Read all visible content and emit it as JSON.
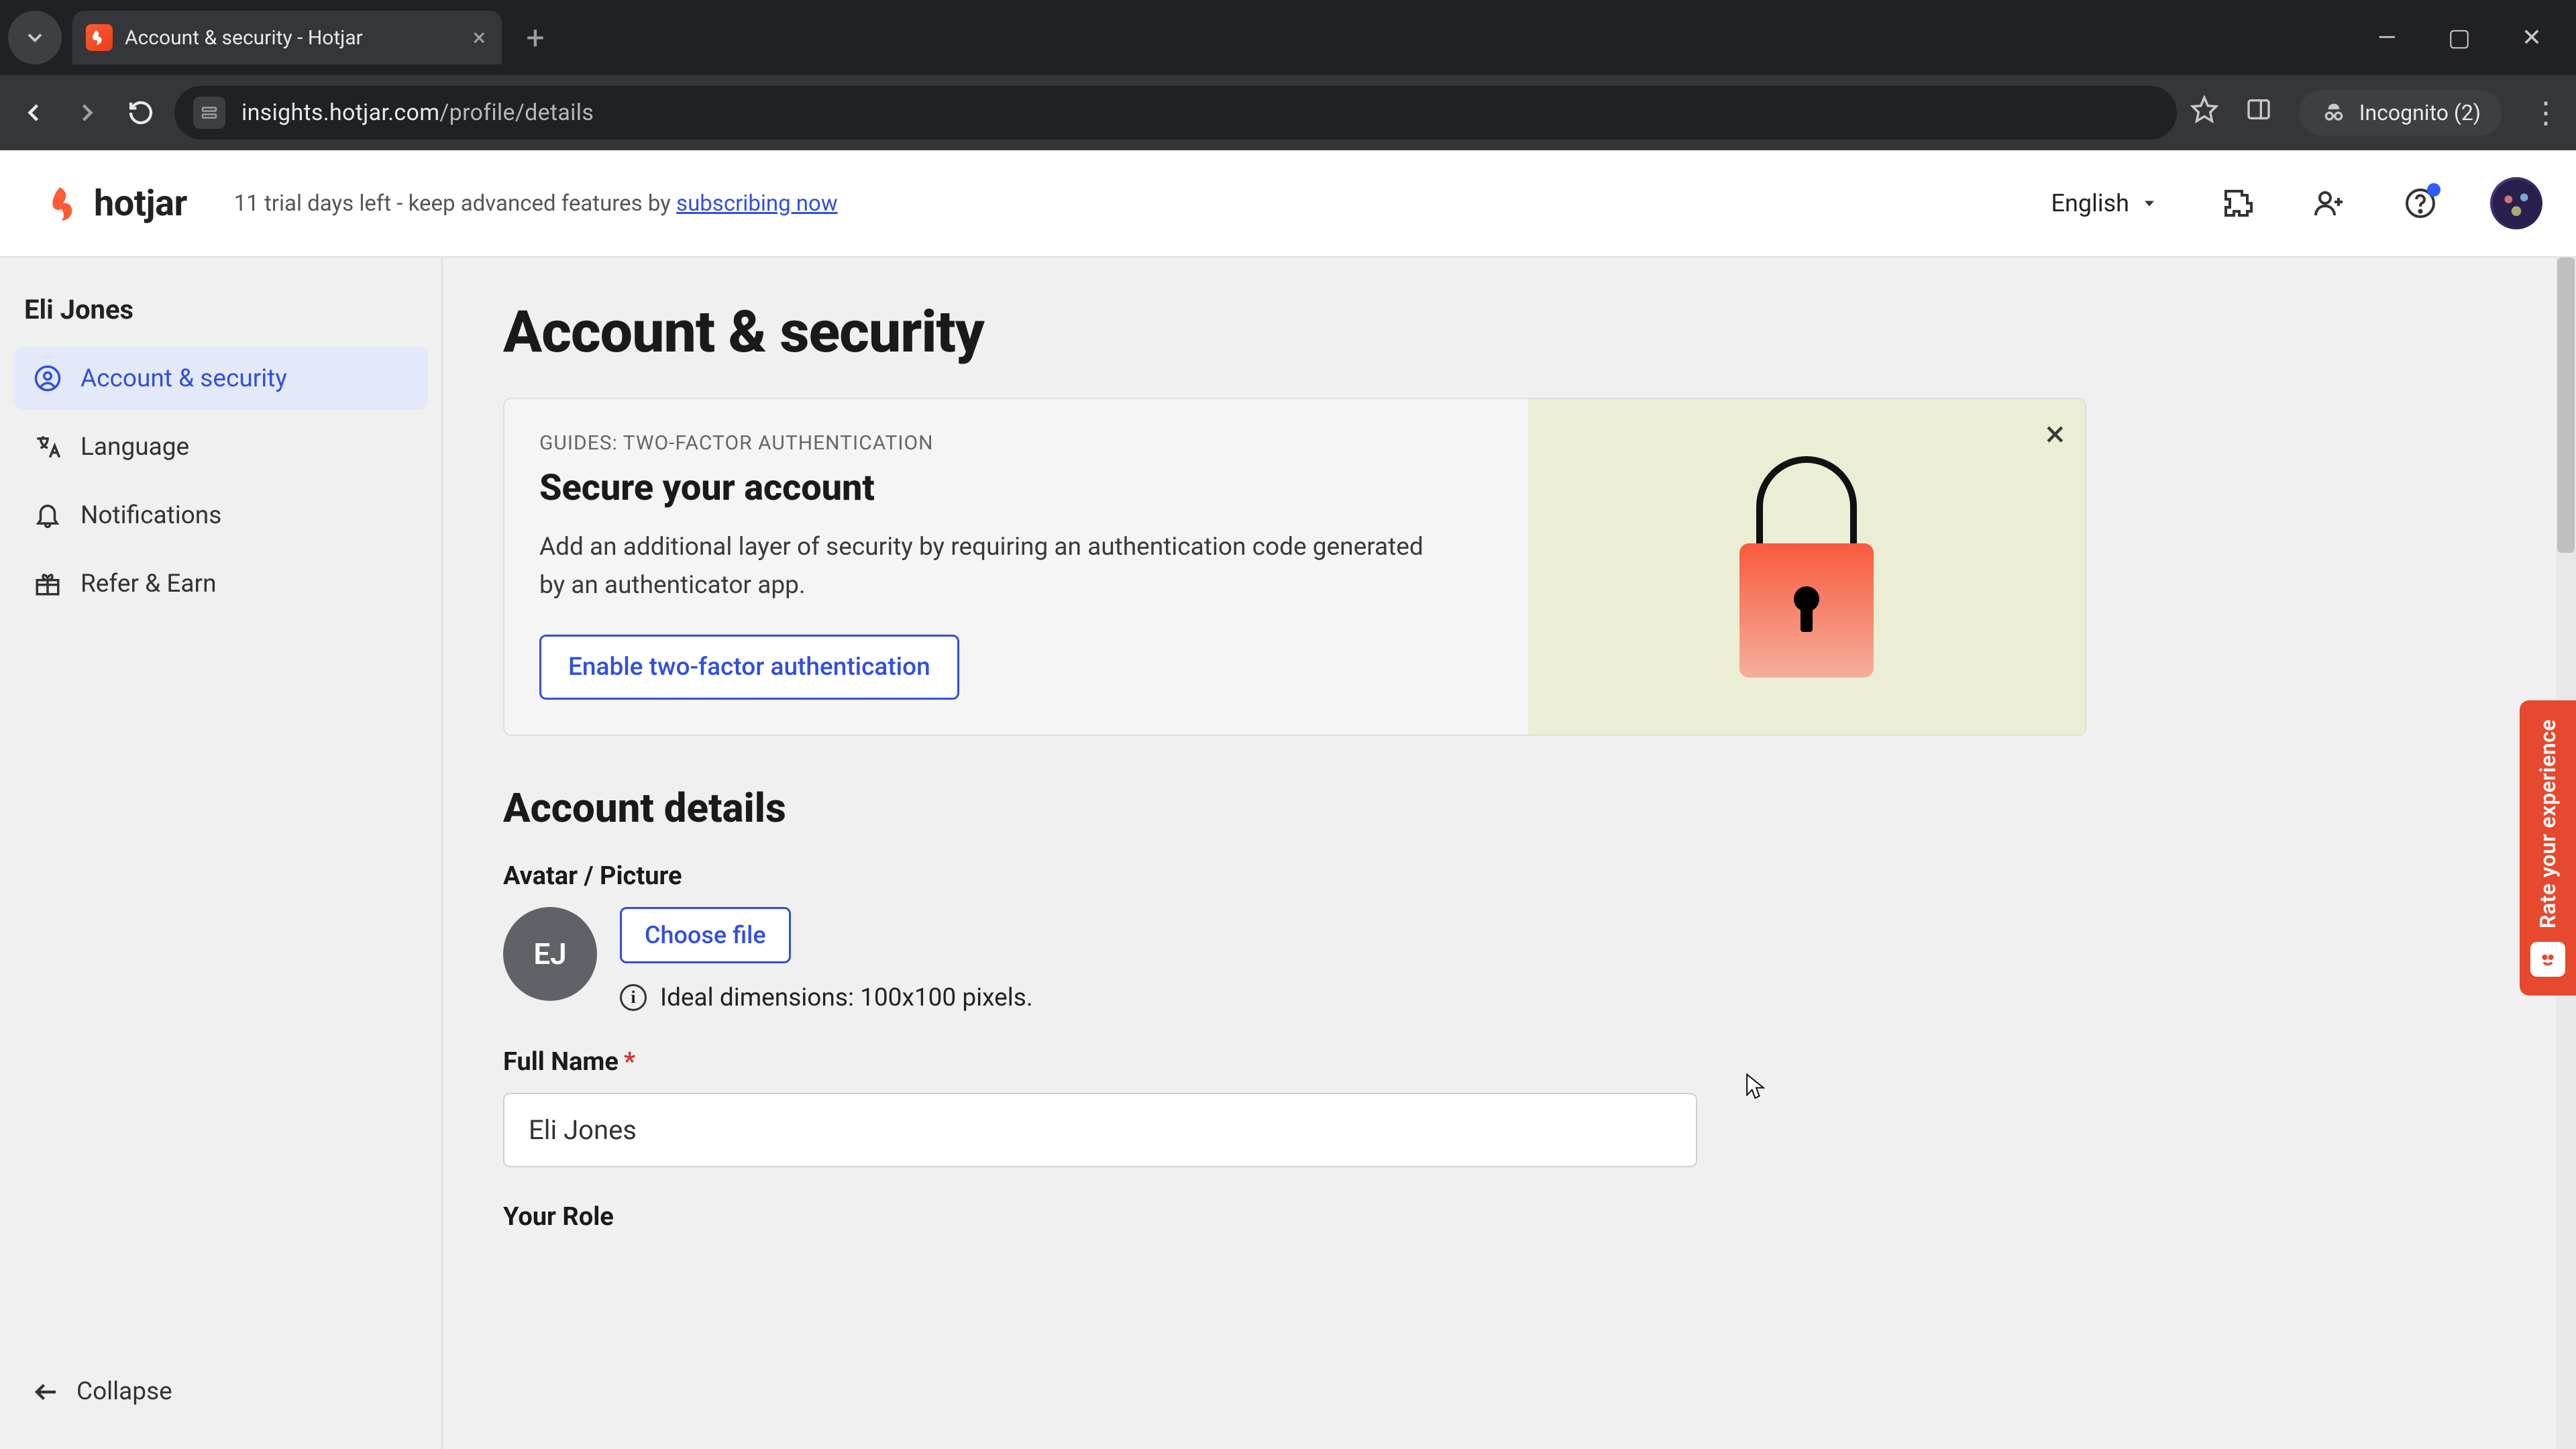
{
  "browser": {
    "tab_title": "Account & security - Hotjar",
    "url_domain": "insights.hotjar.com",
    "url_path": "/profile/details",
    "incognito_label": "Incognito (2)"
  },
  "topbar": {
    "brand": "hotjar",
    "trial_prefix": "11 trial days left - keep advanced features by ",
    "trial_link": "subscribing now",
    "language": "English"
  },
  "sidebar": {
    "user_name": "Eli Jones",
    "items": [
      {
        "label": "Account & security",
        "icon": "user-circle-icon",
        "active": true
      },
      {
        "label": "Language",
        "icon": "translate-icon",
        "active": false
      },
      {
        "label": "Notifications",
        "icon": "bell-icon",
        "active": false
      },
      {
        "label": "Refer & Earn",
        "icon": "gift-icon",
        "active": false
      }
    ],
    "collapse_label": "Collapse"
  },
  "page": {
    "title": "Account & security",
    "guide": {
      "kicker": "GUIDES: TWO-FACTOR AUTHENTICATION",
      "title": "Secure your account",
      "desc": "Add an additional layer of security by requiring an authentication code generated by an authenticator app.",
      "cta": "Enable two-factor authentication"
    },
    "section_account_details": "Account details",
    "avatar": {
      "label": "Avatar / Picture",
      "initials": "EJ",
      "choose_file": "Choose file",
      "hint": "Ideal dimensions: 100x100 pixels."
    },
    "full_name": {
      "label": "Full Name",
      "value": "Eli Jones"
    },
    "your_role_label": "Your Role"
  },
  "feedback_tab": "Rate your experience"
}
